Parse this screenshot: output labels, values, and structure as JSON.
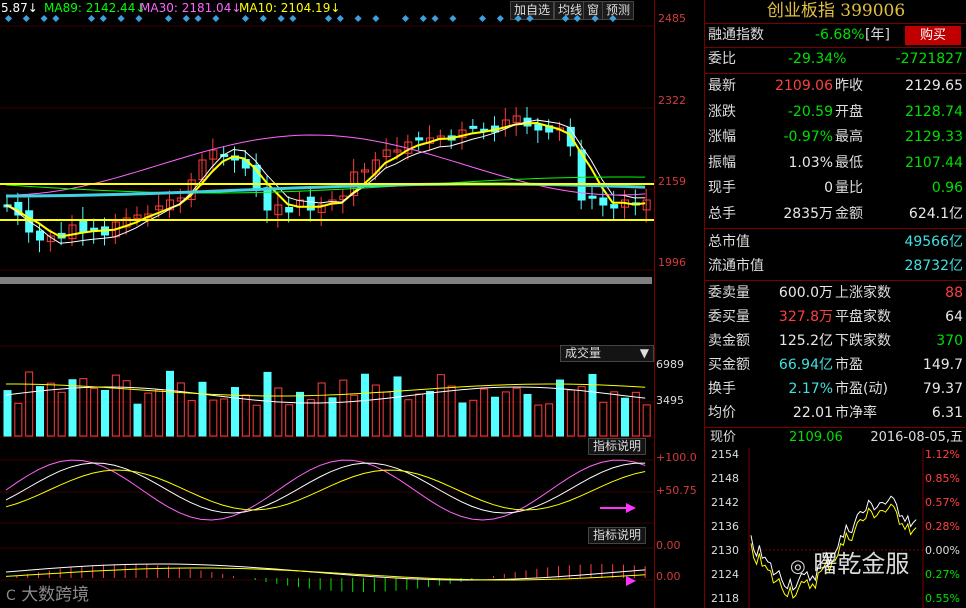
{
  "toolbar": {
    "ma5": "5.87",
    "ma89_label": "MA89:",
    "ma89": "2142.44",
    "ma30_label": "MA30:",
    "ma30": "2181.04",
    "ma10_label": "MA10:",
    "ma10": "2104.19",
    "buttons": [
      "加自选",
      "均线",
      "窗",
      "预测"
    ]
  },
  "price_axis": [
    "2485",
    "2322",
    "2159",
    "1996"
  ],
  "volume": {
    "label": "成交量",
    "axis": [
      "6989",
      "3495"
    ]
  },
  "indicator1": {
    "label": "指标说明",
    "axis": [
      "+100.0",
      "+50.75"
    ]
  },
  "indicator2": {
    "label": "指标说明",
    "axis": [
      "0.00",
      "0.00"
    ]
  },
  "watermark_left": "大数跨境",
  "watermark_right": "曙乾金服",
  "colors": {
    "up": "#ff3c3c",
    "down": "#54ffff",
    "ma5": "#ffffff",
    "ma10": "#ffff00",
    "ma30": "#ff66ff",
    "ma89": "#00ff00",
    "panel_border": "#7a0000",
    "title": "#e0c040"
  },
  "panel": {
    "title": "创业板指 399006",
    "finance_label": "融通指数",
    "finance_value": "-6.68%",
    "finance_unit": "[年]",
    "buy_button": "购买",
    "weibi_label": "委比",
    "weibi_pct": "-29.34%",
    "weibi_diff": "-2721827",
    "stats": [
      {
        "l1": "最新",
        "v1": "2109.06",
        "c1": "r",
        "l2": "昨收",
        "v2": "2129.65",
        "c2": "w"
      },
      {
        "l1": "涨跌",
        "v1": "-20.59",
        "c1": "g",
        "l2": "开盘",
        "v2": "2128.74",
        "c2": "g"
      },
      {
        "l1": "涨幅",
        "v1": "-0.97%",
        "c1": "g",
        "l2": "最高",
        "v2": "2129.33",
        "c2": "g"
      },
      {
        "l1": "振幅",
        "v1": "1.03%",
        "c1": "w",
        "l2": "最低",
        "v2": "2107.44",
        "c2": "g"
      },
      {
        "l1": "现手",
        "v1": "0",
        "c1": "w",
        "l2": "量比",
        "v2": "0.96",
        "c2": "g"
      },
      {
        "l1": "总手",
        "v1": "2835万",
        "c1": "w",
        "l2": "金额",
        "v2": "624.1亿",
        "c2": "w"
      }
    ],
    "market_cap": [
      {
        "label": "总市值",
        "value": "49566亿"
      },
      {
        "label": "流通市值",
        "value": "28732亿"
      }
    ],
    "breadth": [
      {
        "l1": "委卖量",
        "v1": "600.0万",
        "c1": "w",
        "l2": "上涨家数",
        "v2": "88",
        "c2": "r"
      },
      {
        "l1": "委买量",
        "v1": "327.8万",
        "c1": "r",
        "l2": "平盘家数",
        "v2": "64",
        "c2": "w"
      },
      {
        "l1": "卖金额",
        "v1": "125.2亿",
        "c1": "w",
        "l2": "下跌家数",
        "v2": "370",
        "c2": "g"
      },
      {
        "l1": "买金额",
        "v1": "66.94亿",
        "c1": "c",
        "l2": "市盈",
        "v2": "149.7",
        "c2": "w"
      },
      {
        "l1": "换手",
        "v1": "2.17%",
        "c1": "c",
        "l2": "市盈(动)",
        "v2": "79.37",
        "c2": "w"
      },
      {
        "l1": "均价",
        "v1": "22.01",
        "c1": "w",
        "l2": "市净率",
        "v2": "6.31",
        "c2": "w"
      }
    ],
    "mini": {
      "label": "现价",
      "price": "2109.06",
      "date": "2016-08-05,五",
      "y_left": [
        "2154",
        "2148",
        "2142",
        "2136",
        "2130",
        "2124",
        "2118"
      ],
      "y_right": [
        "1.12%",
        "0.85%",
        "0.57%",
        "0.28%",
        "0.00%",
        "0.27%",
        "0.55%"
      ]
    }
  }
}
